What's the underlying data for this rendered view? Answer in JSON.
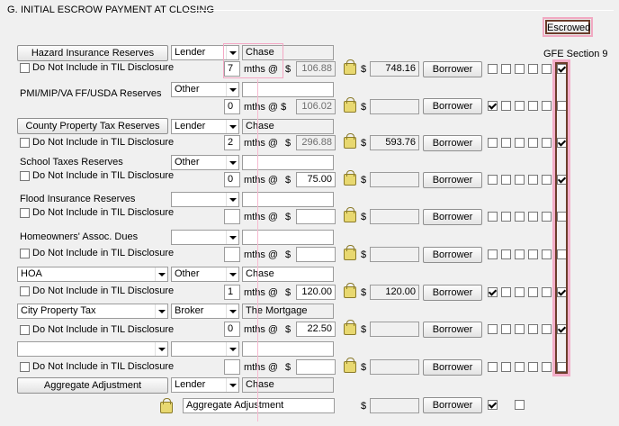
{
  "section_title": "G. INITIAL ESCROW PAYMENT AT CLOSING",
  "escrowed_label": "Escrowed",
  "gfe_section_label": "GFE Section 9",
  "labels": {
    "do_not_include": "Do Not Include in TIL Disclosure",
    "mths_at": "mths @",
    "mths_at_dollar": "mths @ $",
    "dollar": "$",
    "borrower": "Borrower"
  },
  "rows": [
    {
      "name": "Hazard Insurance Reserves",
      "paid_by": "Lender",
      "payee": "Chase",
      "months": "7",
      "amount": "106.88",
      "total": "748.16",
      "escrowed": true
    },
    {
      "name": "PMI/MIP/VA FF/USDA Reserves",
      "paid_by": "Other",
      "payee": "",
      "months": "0",
      "amount": "106.02",
      "total": "",
      "escrowed": false
    },
    {
      "name": "County Property Tax Reserves",
      "paid_by": "Lender",
      "payee": "Chase",
      "months": "2",
      "amount": "296.88",
      "total": "593.76",
      "escrowed": true
    },
    {
      "name": "School Taxes Reserves",
      "paid_by": "Other",
      "payee": "",
      "months": "0",
      "amount": "75.00",
      "total": "",
      "escrowed": true
    },
    {
      "name": "Flood Insurance Reserves",
      "paid_by": "",
      "payee": "",
      "months": "",
      "amount": "",
      "total": "",
      "escrowed": false
    },
    {
      "name": "Homeowners' Assoc. Dues",
      "paid_by": "",
      "payee": "",
      "months": "",
      "amount": "",
      "total": "",
      "escrowed": false
    },
    {
      "name": "HOA",
      "paid_by": "Other",
      "payee": "Chase",
      "months": "1",
      "amount": "120.00",
      "total": "120.00",
      "escrowed": true
    },
    {
      "name": "City Property Tax",
      "paid_by": "Broker",
      "payee": "The Mortgage Brokers",
      "months": "0",
      "amount": "22.50",
      "total": "",
      "escrowed": true
    },
    {
      "name": "",
      "paid_by": "",
      "payee": "",
      "months": "",
      "amount": "",
      "total": "",
      "escrowed": false
    }
  ],
  "aggregate": {
    "button": "Aggregate Adjustment",
    "paid_by": "Lender",
    "payee": "Chase",
    "description": "Aggregate Adjustment"
  }
}
